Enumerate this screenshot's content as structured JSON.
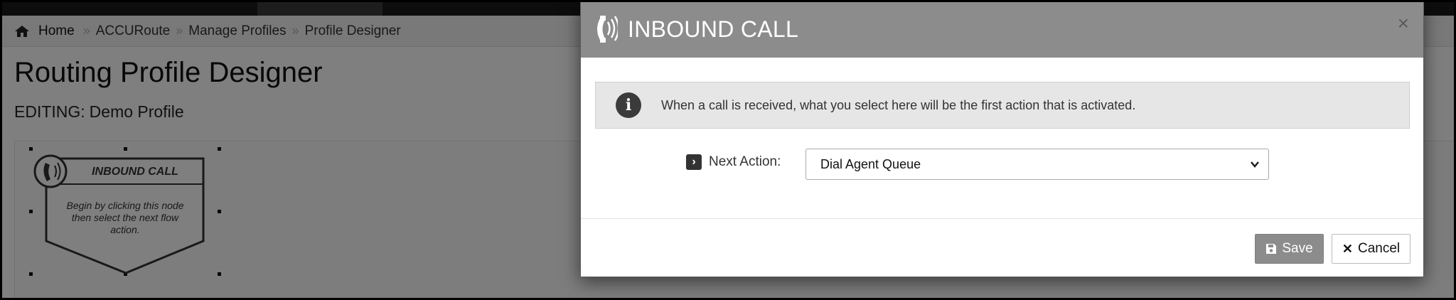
{
  "breadcrumb": {
    "home": "Home",
    "separator": "»",
    "items": [
      "ACCURoute",
      "Manage Profiles",
      "Profile Designer"
    ]
  },
  "page": {
    "title": "Routing Profile Designer",
    "editing_label": "EDITING:",
    "profile_name": "Demo Profile"
  },
  "node": {
    "title": "INBOUND CALL",
    "description_lines": [
      "Begin by clicking this node",
      "then select the next flow",
      "action."
    ],
    "icon": "phone-icon"
  },
  "modal": {
    "title": "INBOUND CALL",
    "title_icon": "phone-icon",
    "close_label": "×",
    "info_text": "When a call is received, what you select here will be the first action that is activated.",
    "info_icon": "info-icon",
    "next_action_label": "Next Action:",
    "next_action_value": "Dial Agent Queue",
    "save_label": "Save",
    "cancel_label": "Cancel"
  },
  "colors": {
    "modal_header": "#8c8c8c",
    "save_button": "#8c8c8c",
    "overlay": "#000000"
  }
}
